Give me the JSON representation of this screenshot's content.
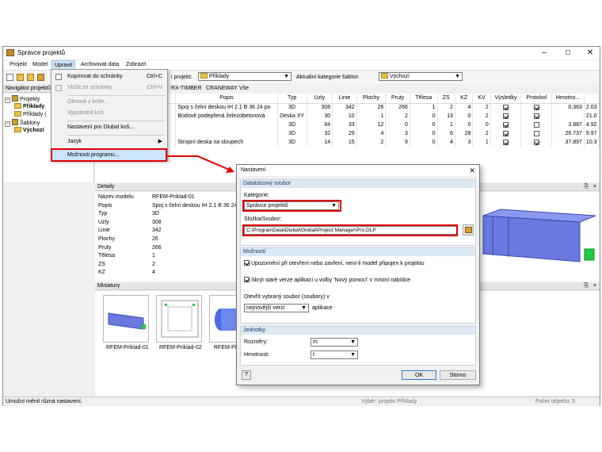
{
  "window": {
    "title": "Správce projektů"
  },
  "menubar": [
    "Projekt",
    "Model",
    "Upravit",
    "Archivovat data",
    "Zobrazit"
  ],
  "edit_menu": {
    "items": [
      {
        "label": "Kopírovat do schránky",
        "shortcut": "Ctrl+C",
        "enabled": true
      },
      {
        "label": "Vložit ze schránky",
        "shortcut": "Ctrl+V",
        "enabled": false
      },
      {
        "label": "Obnovit z koše...",
        "shortcut": "",
        "enabled": false
      },
      {
        "label": "Vyprázdnit koš",
        "shortcut": "",
        "enabled": false
      },
      {
        "label": "Nastavení pro Dlubal koš...",
        "shortcut": "",
        "enabled": true
      },
      {
        "label": "Jazyk",
        "shortcut": "",
        "enabled": true
      },
      {
        "label": "Možnosti programu...",
        "shortcut": "",
        "enabled": true
      }
    ]
  },
  "navigator": {
    "title": "Navigátor projektů",
    "projects_label": "Projekty",
    "project_1": "Příklady",
    "project_2": "Příklady (",
    "templates_label": "Šablony",
    "template_1": "Výchozí"
  },
  "toolbar": {
    "project_label": "i projekt:",
    "project_value": "Příklady",
    "template_cat_label": "Aktuální kategorie šablon",
    "template_cat_value": "Výchozí"
  },
  "tabs": [
    "RX-TIMBER",
    "CRANEWAY",
    "Vše"
  ],
  "table": {
    "headers": [
      "Popis",
      "Typ",
      "Uzly",
      "Linie",
      "Plochy",
      "Pruty",
      "Tělesa",
      "ZS",
      "KZ",
      "KV",
      "Výsledky",
      "Protokol",
      "Hmotno..."
    ],
    "rows": [
      {
        "popis": "Spoj s čelní deskou IH 2.1 B 36 24 po",
        "typ": "3D",
        "uzly": "308",
        "linie": "342",
        "plochy": "26",
        "pruty": "266",
        "telesa": "1",
        "zs": "2",
        "kz": "4",
        "kv": "2",
        "vysledky": true,
        "protokol": true,
        "hmotnost": "0.363",
        "extra": "2.03"
      },
      {
        "popis": "Bodově podepřená železobetonová ",
        "typ": "Deska XY",
        "uzly": "30",
        "linie": "10",
        "plochy": "1",
        "pruty": "2",
        "telesa": "0",
        "zs": "13",
        "kz": "0",
        "kv": "2",
        "vysledky": true,
        "protokol": true,
        "hmotnost": "",
        "extra": "21.0"
      },
      {
        "popis": "",
        "typ": "3D",
        "uzly": "84",
        "linie": "33",
        "plochy": "12",
        "pruty": "0",
        "telesa": "0",
        "zs": "1",
        "kz": "0",
        "kv": "0",
        "vysledky": true,
        "protokol": false,
        "hmotnost": "3.887",
        "extra": "4.92"
      },
      {
        "popis": "",
        "typ": "3D",
        "uzly": "32",
        "linie": "29",
        "plochy": "4",
        "pruty": "3",
        "telesa": "0",
        "zs": "6",
        "kz": "28",
        "kv": "2",
        "vysledky": true,
        "protokol": false,
        "hmotnost": "26.737",
        "extra": "9.97"
      },
      {
        "popis": "Stropní deska na sloupech",
        "typ": "3D",
        "uzly": "14",
        "linie": "15",
        "plochy": "2",
        "pruty": "9",
        "telesa": "0",
        "zs": "4",
        "kz": "3",
        "kv": "1",
        "vysledky": true,
        "protokol": true,
        "hmotnost": "37.897",
        "extra": "10.3"
      }
    ]
  },
  "details": {
    "title": "Detaily",
    "rows": [
      {
        "k": "Název modelu",
        "v": "RFEM-Priklad-01"
      },
      {
        "k": "Popis",
        "v": "Spoj s čelní deskou IH 2.1 B 36 24"
      },
      {
        "k": "Typ",
        "v": "3D"
      },
      {
        "k": "Uzly",
        "v": "308"
      },
      {
        "k": "Linie",
        "v": "342"
      },
      {
        "k": "Plochy",
        "v": "26"
      },
      {
        "k": "Pruty",
        "v": "266"
      },
      {
        "k": "Tělesa",
        "v": "1"
      },
      {
        "k": "ZS",
        "v": "2"
      },
      {
        "k": "KZ",
        "v": "4"
      }
    ]
  },
  "thumbnails": {
    "title": "Miniatury",
    "items": [
      "RFEM-Priklad-01",
      "RFEM-Priklad-02",
      "RFEM-Pi"
    ]
  },
  "dialog": {
    "title": "Nastavení",
    "db_group": "Databázový soubor",
    "category_label": "Kategorie:",
    "category_value": "Správce projektů",
    "folder_label": "Složka/Soubor:",
    "folder_value": "C:\\ProgramData\\Dlubal\\Global\\Project Manager\\Pro.DLP",
    "options_group": "Možnosti",
    "opt1": "Upozornění při otevření nebo zavření, není-li model připojen k projektu",
    "opt2": "Skrýt staré verze aplikací u volby 'Nový pomocí' v místní nabídce",
    "open_label": "Otevřít vybraný soubor (soubory) v",
    "open_value": "nejnovější verzi",
    "open_suffix": "aplikace",
    "units_group": "Jednotky",
    "dim_label": "Rozměry:",
    "dim_value": "m",
    "mass_label": "Hmotnost:",
    "mass_value": "t",
    "ok": "OK",
    "cancel": "Storno"
  },
  "status": {
    "left": "Umožní měnit různá nastavení.",
    "mid": "Výběr: projekt Příklady",
    "right": "Počet objektu: 5"
  },
  "colors": {
    "highlight_red": "#e00000",
    "selected_blue": "#cce4f7",
    "check_green": "#22aa22"
  }
}
